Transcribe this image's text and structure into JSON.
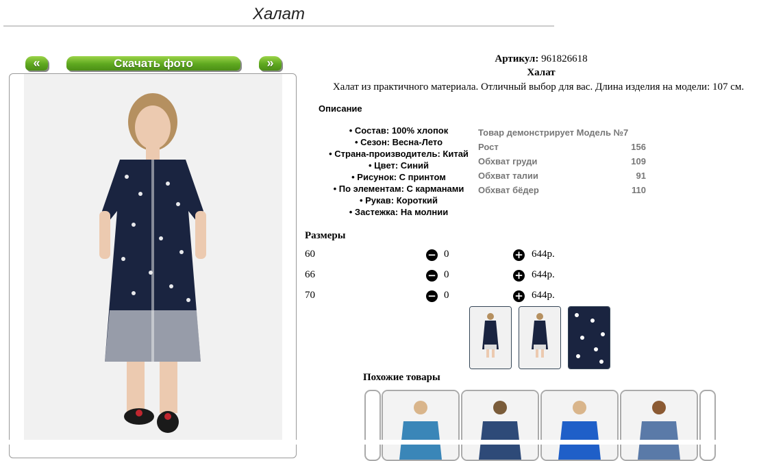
{
  "header": {
    "title": "Халат"
  },
  "gallery": {
    "prev_label": "«",
    "download_label": "Скачать фото",
    "next_label": "»"
  },
  "product": {
    "article_label": "Артикул:",
    "article_value": "961826618",
    "name": "Халат",
    "description": "Халат из практичного материала. Отличный выбор для вас. Длина изделия на модели: 107 см.",
    "description_heading": "Описание",
    "features": [
      "Состав: 100% хлопок",
      "Сезон: Весна-Лето",
      "Страна-производитель: Китай",
      "Цвет: Синий",
      "Рисунок: С принтом",
      "По элементам: С карманами",
      "Рукав: Короткий",
      "Застежка: На молнии"
    ],
    "model": {
      "heading": "Товар демонстрирует Модель №7",
      "rows": [
        {
          "label": "Рост",
          "value": "156"
        },
        {
          "label": "Обхват груди",
          "value": "109"
        },
        {
          "label": "Обхват талии",
          "value": "91"
        },
        {
          "label": "Обхват бёдер",
          "value": "110"
        }
      ]
    }
  },
  "sizes": {
    "heading": "Размеры",
    "minus_icon": "minus-circle-icon",
    "plus_icon": "plus-circle-icon",
    "rows": [
      {
        "size": "60",
        "qty": "0",
        "price": "644р."
      },
      {
        "size": "66",
        "qty": "0",
        "price": "644р."
      },
      {
        "size": "70",
        "qty": "0",
        "price": "644р."
      }
    ]
  },
  "similar": {
    "heading": "Похожие товары"
  },
  "colors": {
    "accent_green": "#5ea81f",
    "dress_navy": "#1a2440"
  }
}
